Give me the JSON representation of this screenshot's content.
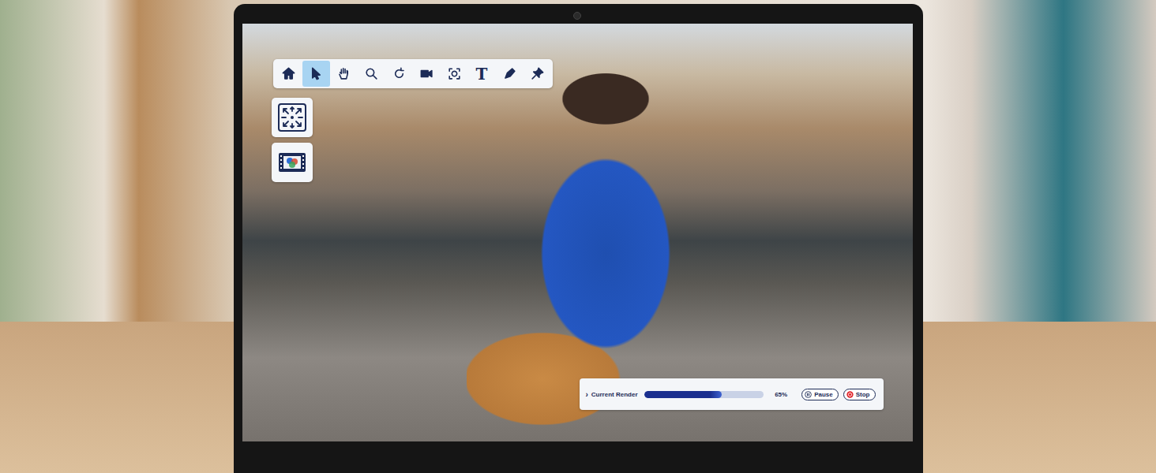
{
  "toolbar": {
    "tools": [
      {
        "kind": "icon",
        "selected": false
      },
      {
        "kind": "icon",
        "selected": true
      },
      {
        "kind": "icon",
        "selected": false
      },
      {
        "kind": "icon",
        "selected": false
      },
      {
        "kind": "icon",
        "selected": false
      },
      {
        "kind": "icon",
        "selected": false
      },
      {
        "kind": "icon",
        "selected": false
      },
      {
        "kind": "glyph",
        "glyph": "T",
        "selected": false
      },
      {
        "kind": "icon",
        "selected": false
      },
      {
        "kind": "icon",
        "selected": false
      }
    ]
  },
  "render": {
    "expander": "›",
    "label": "Current Render",
    "level": 0.65,
    "reading": "65%",
    "buttons": [
      {
        "label": "Pause"
      },
      {
        "label": "Stop"
      }
    ]
  }
}
